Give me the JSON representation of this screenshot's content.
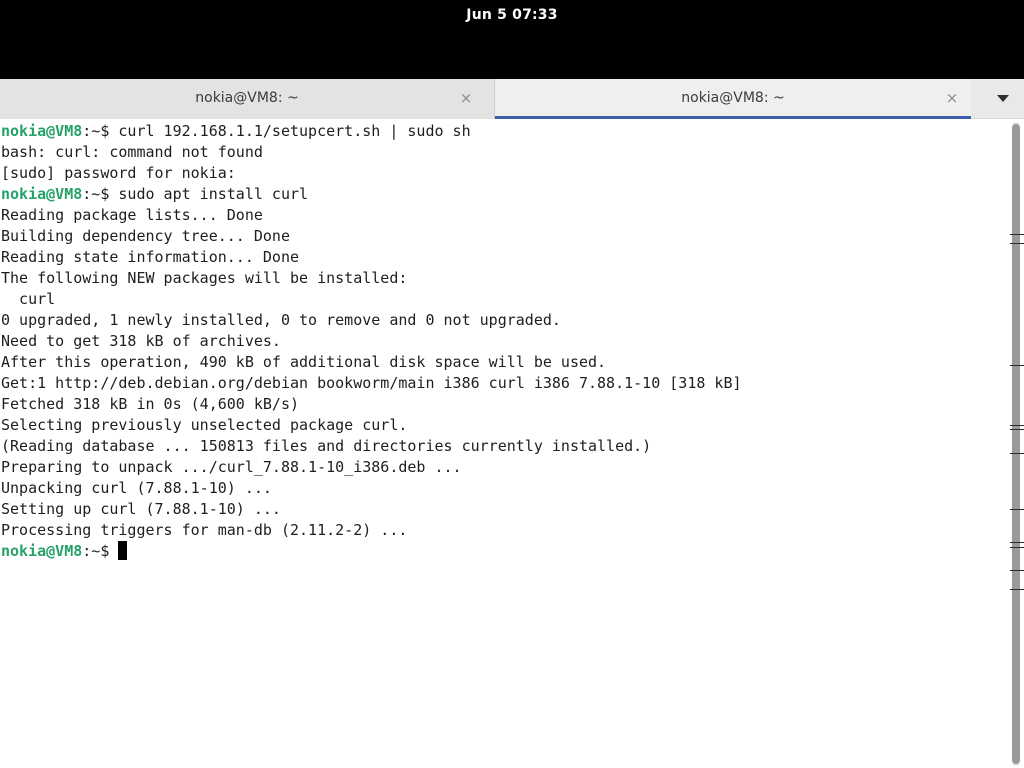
{
  "topbar": {
    "datetime": "Jun 5  07:33"
  },
  "tabs": [
    {
      "label": "nokia@VM8: ~",
      "close": "×",
      "active": false
    },
    {
      "label": "nokia@VM8: ~",
      "close": "×",
      "active": true
    }
  ],
  "tab_menu_icon": "chevron-down-icon",
  "terminal": {
    "prompt": "nokia@VM8",
    "prompt_suffix": ":~$ ",
    "lines": [
      {
        "type": "cmd",
        "text": "curl 192.168.1.1/setupcert.sh | sudo sh"
      },
      {
        "type": "out",
        "text": "bash: curl: command not found"
      },
      {
        "type": "out",
        "text": "[sudo] password for nokia:"
      },
      {
        "type": "cmd",
        "text": "sudo apt install curl"
      },
      {
        "type": "out",
        "text": "Reading package lists... Done"
      },
      {
        "type": "out",
        "text": "Building dependency tree... Done"
      },
      {
        "type": "out",
        "text": "Reading state information... Done"
      },
      {
        "type": "out",
        "text": "The following NEW packages will be installed:"
      },
      {
        "type": "out",
        "text": "  curl"
      },
      {
        "type": "out",
        "text": "0 upgraded, 1 newly installed, 0 to remove and 0 not upgraded."
      },
      {
        "type": "out",
        "text": "Need to get 318 kB of archives."
      },
      {
        "type": "out",
        "text": "After this operation, 490 kB of additional disk space will be used."
      },
      {
        "type": "out",
        "text": "Get:1 http://deb.debian.org/debian bookworm/main i386 curl i386 7.88.1-10 [318 kB]"
      },
      {
        "type": "out",
        "text": "Fetched 318 kB in 0s (4,600 kB/s)"
      },
      {
        "type": "out",
        "text": "Selecting previously unselected package curl."
      },
      {
        "type": "out",
        "text": "(Reading database ... 150813 files and directories currently installed.)"
      },
      {
        "type": "out",
        "text": "Preparing to unpack .../curl_7.88.1-10_i386.deb ..."
      },
      {
        "type": "out",
        "text": "Unpacking curl (7.88.1-10) ..."
      },
      {
        "type": "out",
        "text": "Setting up curl (7.88.1-10) ..."
      },
      {
        "type": "out",
        "text": "Processing triggers for man-db (2.11.2-2) ..."
      },
      {
        "type": "cmd",
        "text": ""
      }
    ]
  },
  "colors": {
    "prompt": "#26a269",
    "active_tab_underline": "#3b5fa8",
    "topbar": "#000000"
  }
}
